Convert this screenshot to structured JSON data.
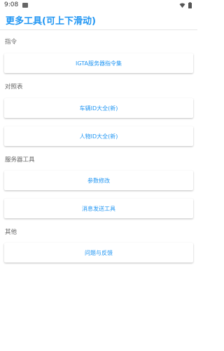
{
  "status_bar": {
    "time": "9:08"
  },
  "header": {
    "title": "更多工具(可上下滑动)"
  },
  "sections": [
    {
      "label": "指令",
      "items": [
        {
          "label": "IGTA服务器指令集"
        }
      ]
    },
    {
      "label": "对照表",
      "items": [
        {
          "label": "车辆ID大全(新)"
        },
        {
          "label": "人物ID大全(新)"
        }
      ]
    },
    {
      "label": "服务器工具",
      "items": [
        {
          "label": "参数修改"
        },
        {
          "label": "消息发送工具"
        }
      ]
    },
    {
      "label": "其他",
      "items": [
        {
          "label": "问题与反馈"
        }
      ]
    }
  ],
  "colors": {
    "accent": "#2196f3",
    "label_gray": "#666666",
    "background": "#ffffff"
  }
}
